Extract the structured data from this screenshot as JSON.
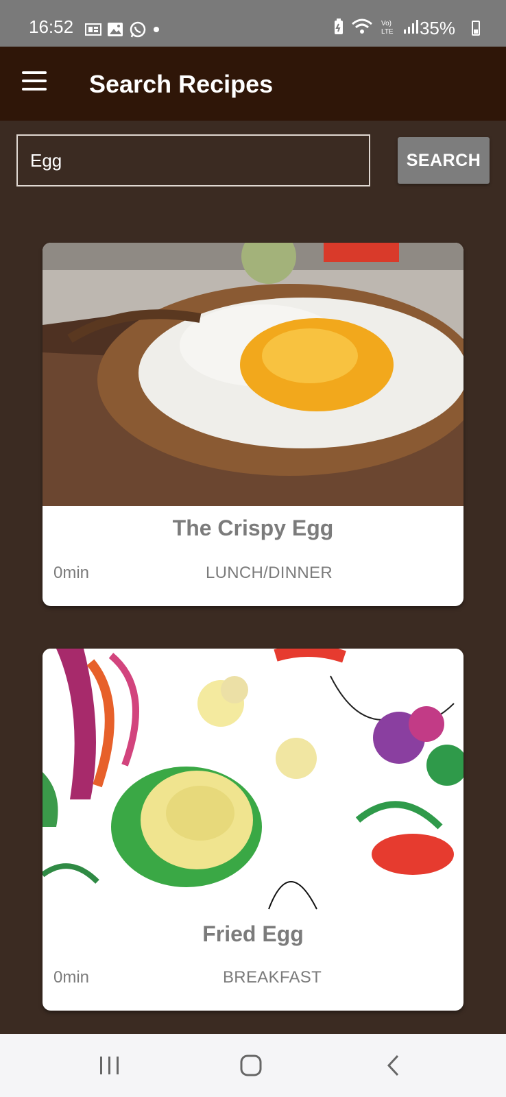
{
  "status_bar": {
    "time": "16:52",
    "battery": "35%",
    "left_icons": [
      "sim-card-icon",
      "gallery-icon",
      "whatsapp-icon",
      "notification-dot-icon"
    ],
    "right_icons": [
      "battery-saver-icon",
      "wifi-calling-icon",
      "volte-icon",
      "signal-icon",
      "battery-icon"
    ]
  },
  "app_bar": {
    "title": "Search Recipes",
    "menu_icon": "hamburger-menu-icon"
  },
  "search": {
    "value": "Egg",
    "button_label": "SEARCH"
  },
  "recipes": [
    {
      "title": "The Crispy Egg",
      "time": "0min",
      "category": "LUNCH/DINNER",
      "image": "fried-egg-on-toast-photo"
    },
    {
      "title": "Fried Egg",
      "time": "0min",
      "category": "BREAKFAST",
      "image": "vegetable-watercolor-illustration"
    }
  ],
  "nav_bar": {
    "buttons": [
      "recent-apps-icon",
      "home-icon",
      "back-icon"
    ]
  },
  "colors": {
    "status_bar": "#7a7a7a",
    "app_bar": "#2f1608",
    "background": "#3b2b22",
    "search_button": "#7d7d7d",
    "card_text": "#7b7b7b"
  }
}
